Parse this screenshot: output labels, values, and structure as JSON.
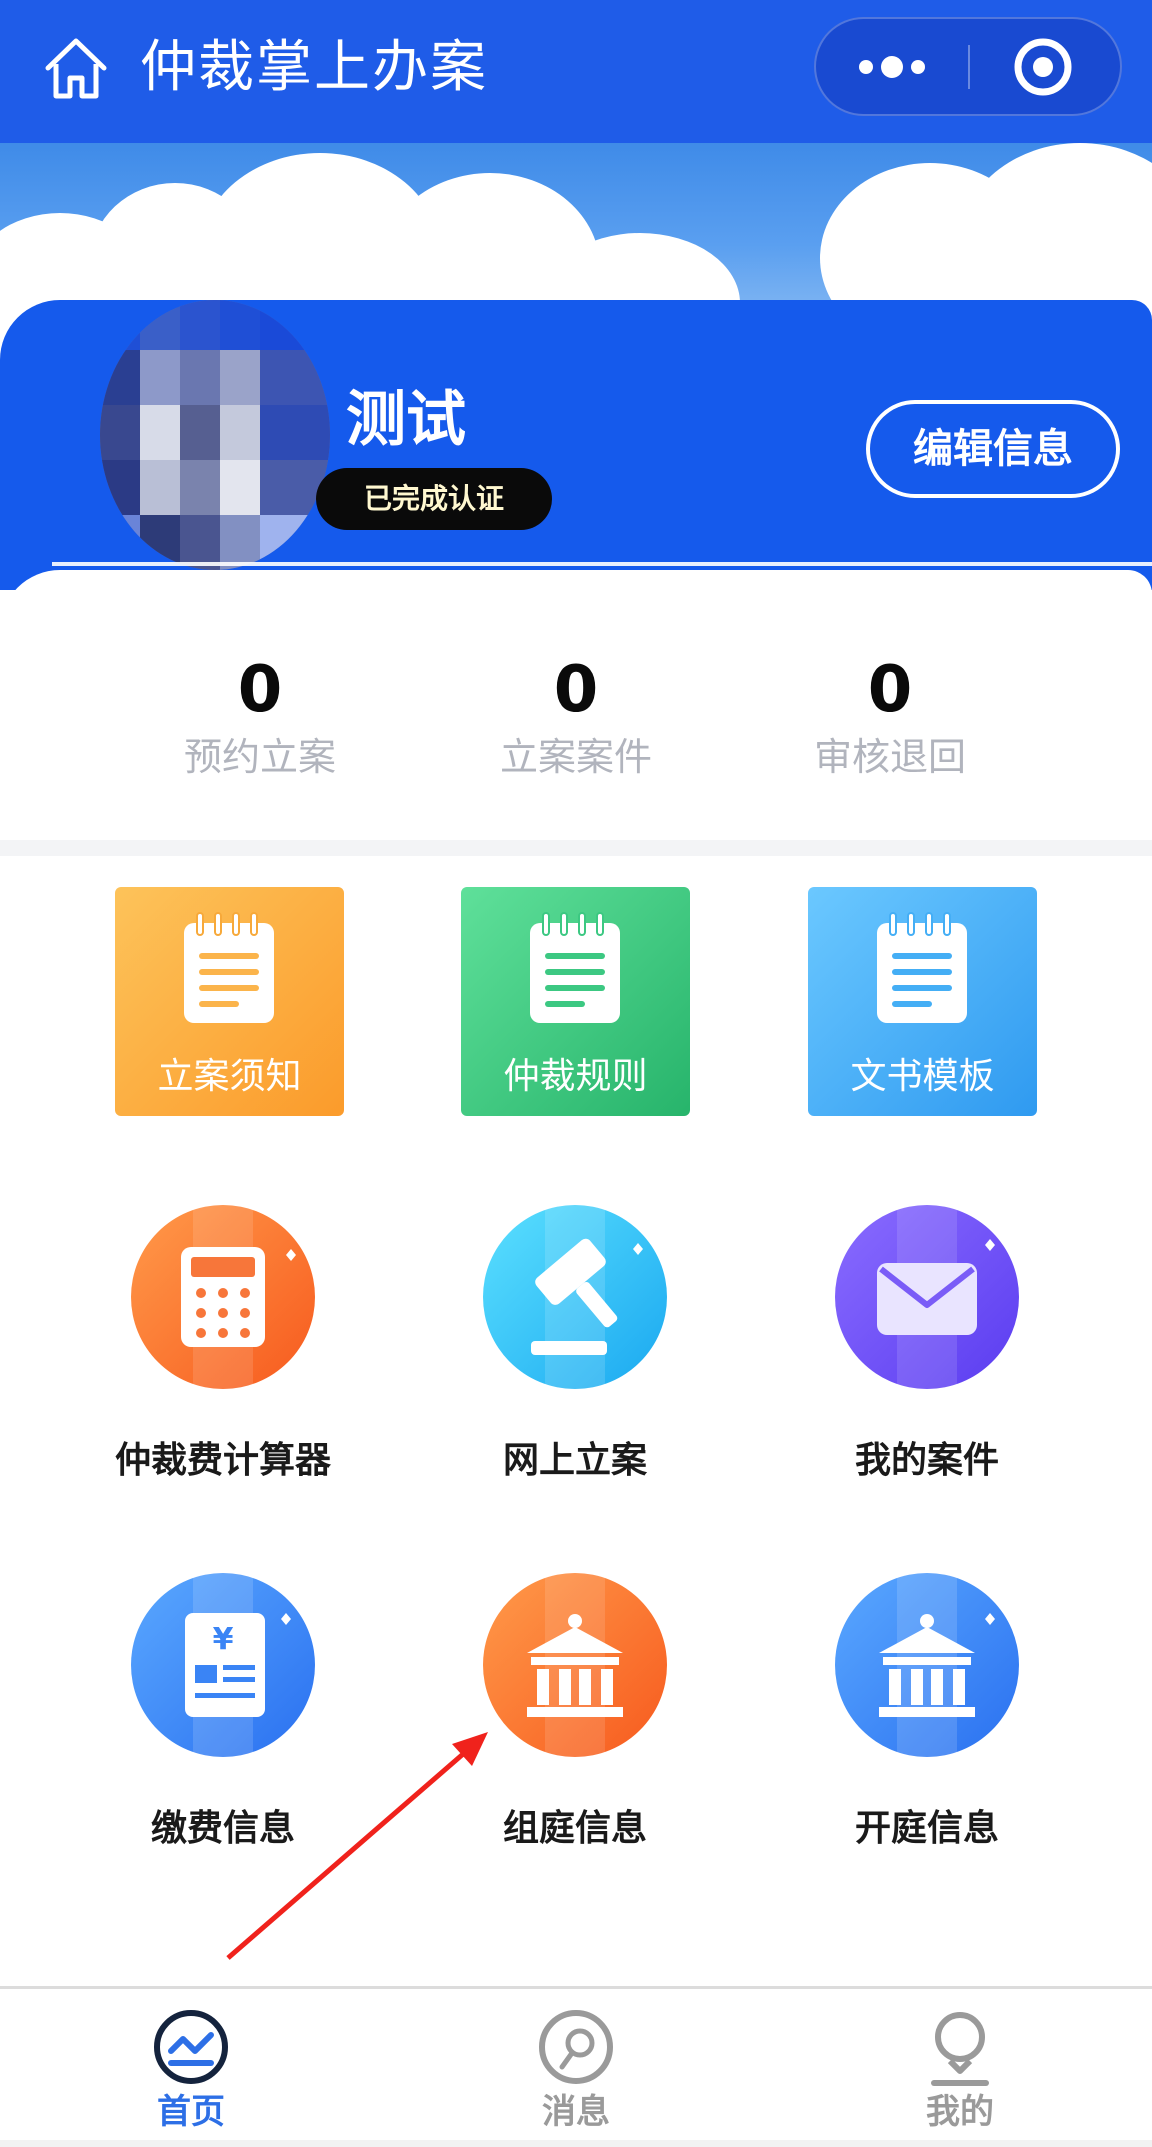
{
  "navbar": {
    "title": "仲裁掌上办案",
    "home_icon": "home-icon",
    "more_icon": "more-dots-icon",
    "close_icon": "target-close-icon",
    "background": "#1f5ce8"
  },
  "profile": {
    "name": "测试",
    "badge": "已完成认证",
    "edit_label": "编辑信息",
    "accent": "#155aec"
  },
  "stats": [
    {
      "value": "0",
      "label": "预约立案"
    },
    {
      "value": "0",
      "label": "立案案件"
    },
    {
      "value": "0",
      "label": "审核退回"
    }
  ],
  "cards": [
    {
      "label": "立案须知",
      "icon": "notepad-icon",
      "color_from": "#fdc35a",
      "color_to": "#fb9b2b"
    },
    {
      "label": "仲裁规则",
      "icon": "notepad-icon",
      "color_from": "#5fe09a",
      "color_to": "#27b46b"
    },
    {
      "label": "文书模板",
      "icon": "notepad-icon",
      "color_from": "#6bc8ff",
      "color_to": "#2f9af0"
    }
  ],
  "tiles": [
    {
      "label": "仲裁费计算器",
      "icon": "calculator-icon",
      "color_from": "#ff9a4a",
      "color_to": "#f75a1e"
    },
    {
      "label": "网上立案",
      "icon": "gavel-icon",
      "color_from": "#5be0ff",
      "color_to": "#1aa8f0"
    },
    {
      "label": "我的案件",
      "icon": "mail-icon",
      "color_from": "#8a6cff",
      "color_to": "#5a3cf0"
    },
    {
      "label": "缴费信息",
      "icon": "receipt-icon",
      "color_from": "#5aa8ff",
      "color_to": "#2a70f0"
    },
    {
      "label": "组庭信息",
      "icon": "courthouse-icon",
      "color_from": "#ff9a4a",
      "color_to": "#f75a1e"
    },
    {
      "label": "开庭信息",
      "icon": "courthouse-icon",
      "color_from": "#5aa8ff",
      "color_to": "#2a70f0"
    }
  ],
  "tabbar": {
    "items": [
      {
        "label": "首页",
        "icon": "home-chart-icon",
        "active": true
      },
      {
        "label": "消息",
        "icon": "message-icon",
        "active": false
      },
      {
        "label": "我的",
        "icon": "user-icon",
        "active": false
      }
    ],
    "active_color": "#2d6fe6",
    "inactive_color": "#9a9a9a"
  }
}
